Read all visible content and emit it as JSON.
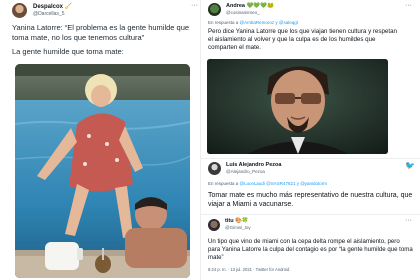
{
  "left_tweet": {
    "display_name": "Despalcox 🧹",
    "handle": "@Darcellas_5",
    "more_label": "···",
    "text_line1": "Yanina Latorre: “El problema es la gente humilde que toma mate, no los que tenemos cultura”",
    "text_line2": "La gente humilde que toma mate:"
  },
  "tweet1": {
    "display_name": "Andrea 💚💚💚🐸",
    "handle": "@cosinamimeo_",
    "more_label": "···",
    "reply_prefix": "En respuesta a",
    "reply_to": "@AmbaRemoroz y @saleqgl",
    "text": "Pero dice Yanina Latorre que los que viajan tienen cultura y respetan el aislamiento al volver y que la culpa es de los humildes que comparten el mate."
  },
  "tweet2": {
    "display_name": "Luis Alejandro Pezoa",
    "handle": "@Alejandro_Pezoa",
    "reply_prefix": "En respuesta a",
    "reply_to": "@LuceLaudi @SASR47621 y @yanidotorm",
    "text": "Tomar mate es mucho más representativo de nuestra cultura, que viajar a Miami a vacunarse."
  },
  "tweet3": {
    "display_name": "titu 🎨🍀",
    "handle": "@Gimisi_toy",
    "more_label": "···",
    "text": "Un tipo que vino de miami con la cepa delta rompe el aislamiento, pero para Yanina Latorre la culpa del contagio es por “la gente humilde que toma mate”",
    "meta": "8:24 p. m. · 13 jul. 2021 · Twitter for Android"
  }
}
